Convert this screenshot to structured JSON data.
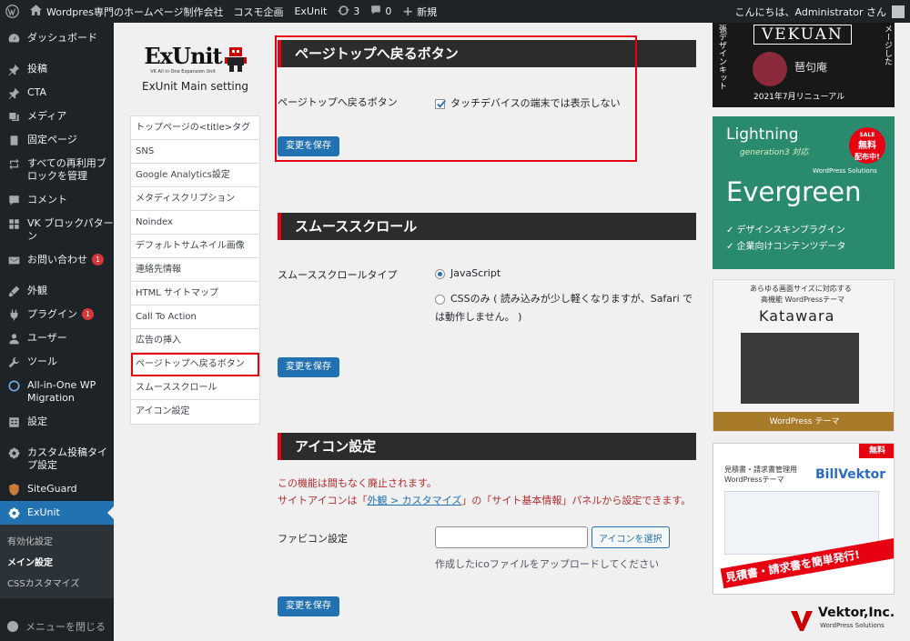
{
  "adminbar": {
    "site_title": "Wordpres専門のホームページ制作会社　コスモ企画",
    "exunit": "ExUnit",
    "updates": "3",
    "comments": "0",
    "new": "新規",
    "greeting": "こんにちは、Administrator さん"
  },
  "sidebar": {
    "items": [
      {
        "label": "ダッシュボード",
        "icon": "dashboard-icon"
      },
      {
        "label": "投稿",
        "icon": "pin-icon"
      },
      {
        "label": "CTA",
        "icon": "pin-icon"
      },
      {
        "label": "メディア",
        "icon": "media-icon"
      },
      {
        "label": "固定ページ",
        "icon": "page-icon"
      },
      {
        "label": "すべての再利用ブロックを管理",
        "icon": "reuse-icon"
      },
      {
        "label": "コメント",
        "icon": "comment-icon"
      },
      {
        "label": "VK ブロックパターン",
        "icon": "grid-icon"
      },
      {
        "label": "お問い合わせ",
        "icon": "mail-icon",
        "badge": "1"
      },
      {
        "label": "外観",
        "icon": "brush-icon"
      },
      {
        "label": "プラグイン",
        "icon": "plugin-icon",
        "badge": "1"
      },
      {
        "label": "ユーザー",
        "icon": "user-icon"
      },
      {
        "label": "ツール",
        "icon": "wrench-icon"
      },
      {
        "label": "All-in-One WP Migration",
        "icon": "migration-icon"
      },
      {
        "label": "設定",
        "icon": "settings-icon"
      },
      {
        "label": "カスタム投稿タイプ設定",
        "icon": "gear-icon"
      },
      {
        "label": "SiteGuard",
        "icon": "siteguard-icon"
      },
      {
        "label": "ExUnit",
        "icon": "gear-icon"
      }
    ],
    "submenu": [
      "有効化設定",
      "メイン設定",
      "CSSカスタマイズ"
    ],
    "collapse": "メニューを閉じる"
  },
  "settings_nav": {
    "logo_text": "ExUnit",
    "logo_sub": "VK All in One Expansion Unit",
    "title": "ExUnit Main setting",
    "items": [
      "トップページの<title>タグ",
      "SNS",
      "Google Analytics設定",
      "メタディスクリプション",
      "Noindex",
      "デフォルトサムネイル画像",
      "連絡先情報",
      "HTML サイトマップ",
      "Call To Action",
      "広告の挿入",
      "ページトップへ戻るボタン",
      "スムーススクロール",
      "アイコン設定"
    ]
  },
  "pagetop": {
    "heading": "ページトップへ戻るボタン",
    "label": "ページトップへ戻るボタン",
    "checkbox_label": "タッチデバイスの端末では表示しない",
    "checked": true,
    "save": "変更を保存"
  },
  "smooth": {
    "heading": "スムーススクロール",
    "label": "スムーススクロールタイプ",
    "opt1": "JavaScript",
    "opt2_line1": "CSSのみ ( 読み込みが少し軽くなりますが、Safari で",
    "opt2_line2": "は動作しません。 )",
    "selected": "JavaScript",
    "save": "変更を保存"
  },
  "icon": {
    "heading": "アイコン設定",
    "notice1": "この機能は間もなく廃止されます。",
    "notice2_pre": "サイトアイコンは「",
    "notice2_link": "外観 > カスタマイズ",
    "notice2_post": "」の「サイト基本情報」パネルから設定できます。",
    "favicon_label": "ファビコン設定",
    "favicon_value": "",
    "select_btn": "アイコンを選択",
    "help": "作成したicoファイルをアップロードしてください",
    "save": "変更を保存"
  },
  "ads": {
    "vekuan_title": "VEKUAN",
    "vekuan_left": "張デザインキット",
    "vekuan_right": "メージした",
    "vekuan_date": "2021年7月リニューアル",
    "lightning": "Lightning",
    "generation": "generation3 対応",
    "evergreen": "Evergreen",
    "wp_solutions": "WordPress Solutions",
    "sale_badge": "SALE",
    "sale_line1": "無料",
    "sale_line2": "配布中!",
    "ev_bullet1": "✓ デザインスキンプラグイン",
    "ev_bullet2": "✓ 企業向けコンテンツデータ",
    "katawara_line1": "あらゆる画面サイズに対応する",
    "katawara_line2": "高機能 WordPressテーマ",
    "katawara": "Katawara",
    "katawara_footer": "WordPress テーマ",
    "bill_line1": "見積書・請求書管理用",
    "bill_line2": "WordPressテーマ",
    "billvektor": "BillVektor",
    "bill_free": "無料",
    "bill_banner": "見積書・請求書を簡単発行!",
    "vektor": "Vektor,Inc.",
    "vektor_sub": "WordPress Solutions"
  }
}
